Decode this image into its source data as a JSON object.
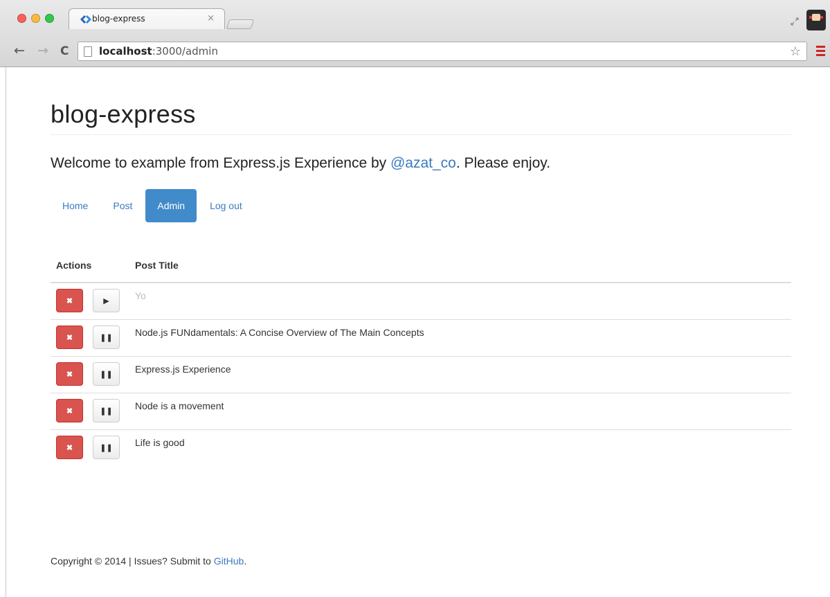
{
  "browser": {
    "tab_title": "blog-express",
    "tab_close": "×",
    "url_host": "localhost",
    "url_path": ":3000/admin",
    "back_glyph": "←",
    "forward_glyph": "→",
    "reload_glyph": "C",
    "star_glyph": "☆",
    "icons": [
      "back-icon",
      "forward-icon",
      "reload-icon",
      "page-icon",
      "star-icon",
      "menu-icon"
    ]
  },
  "page": {
    "title": "blog-express",
    "lead_prefix": "Welcome to example from Express.js Experience by ",
    "lead_link": "@azat_co",
    "lead_suffix": ". Please enjoy.",
    "nav": [
      {
        "label": "Home",
        "active": false
      },
      {
        "label": "Post",
        "active": false
      },
      {
        "label": "Admin",
        "active": true
      },
      {
        "label": "Log out",
        "active": false
      }
    ],
    "table": {
      "headers": [
        "Actions",
        "Post Title"
      ],
      "rows": [
        {
          "title": "Yo",
          "published": false,
          "toggle_icon": "▶",
          "delete_icon": "✖"
        },
        {
          "title": "Node.js FUNdamentals: A Concise Overview of The Main Concepts",
          "published": true,
          "toggle_icon": "❚❚",
          "delete_icon": "✖"
        },
        {
          "title": "Express.js Experience",
          "published": true,
          "toggle_icon": "❚❚",
          "delete_icon": "✖"
        },
        {
          "title": "Node is a movement",
          "published": true,
          "toggle_icon": "❚❚",
          "delete_icon": "✖"
        },
        {
          "title": "Life is good",
          "published": true,
          "toggle_icon": "❚❚",
          "delete_icon": "✖"
        }
      ]
    },
    "footer_prefix": "Copyright © 2014 | Issues? Submit to ",
    "footer_link": "GitHub",
    "footer_suffix": "."
  },
  "colors": {
    "link": "#3a7ac0",
    "active_nav": "#428bca",
    "danger": "#d9534f"
  }
}
